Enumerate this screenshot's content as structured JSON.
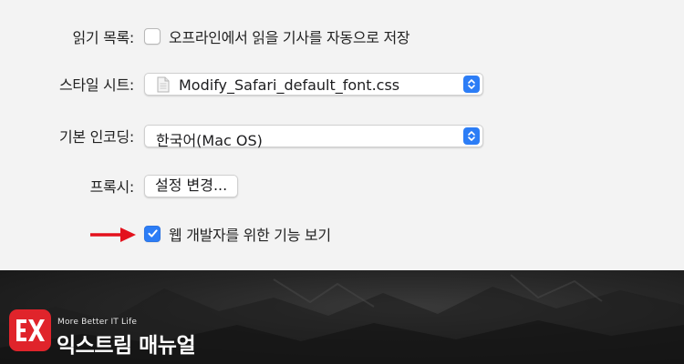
{
  "preferences": {
    "reading_list": {
      "label": "읽기 목록:",
      "checkbox_label": "오프라인에서 읽을 기사를 자동으로 저장",
      "checked": false
    },
    "style_sheet": {
      "label": "스타일 시트:",
      "value": "Modify_Safari_default_font.css"
    },
    "default_encoding": {
      "label": "기본 인코딩:",
      "value": "한국어(Mac OS)"
    },
    "proxies": {
      "label": "프록시:",
      "button_label": "설정 변경..."
    },
    "develop_menu": {
      "checkbox_label": "웹 개발자를 위한 기능 보기",
      "checked": true
    }
  },
  "annotation": {
    "arrow_color": "#e3111c"
  },
  "watermark": {
    "logo_letters": "EX",
    "tagline": "More Better IT Life",
    "brand_name": "익스트림 매뉴얼",
    "brand_color": "#e0242b"
  },
  "colors": {
    "accent": "#2c7df6",
    "panel_background": "#f3f3f3"
  }
}
